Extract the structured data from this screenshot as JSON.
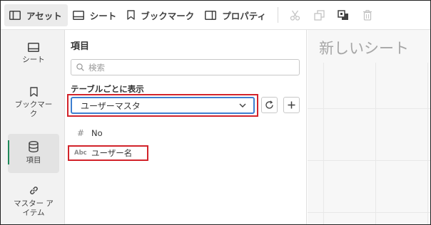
{
  "toolbar": {
    "assets": "アセット",
    "sheets": "シート",
    "bookmarks": "ブックマーク",
    "properties": "プロパティ"
  },
  "rail": {
    "sheet": "シート",
    "bookmark": "ブックマーク",
    "fields": "項目",
    "master_items": "マスター アイテム"
  },
  "panel": {
    "title": "項目",
    "search_placeholder": "検索",
    "table_label": "テーブルごとに表示",
    "selected_table": "ユーザーマスタ",
    "fields": [
      {
        "type": "#",
        "name": "No"
      },
      {
        "type": "Abc",
        "name": "ユーザー名"
      }
    ]
  },
  "canvas": {
    "sheet_title": "新しいシート"
  },
  "colors": {
    "highlight": "#d2232a",
    "focus": "#3e7fd0",
    "active_indicator": "#1e8a5a"
  }
}
